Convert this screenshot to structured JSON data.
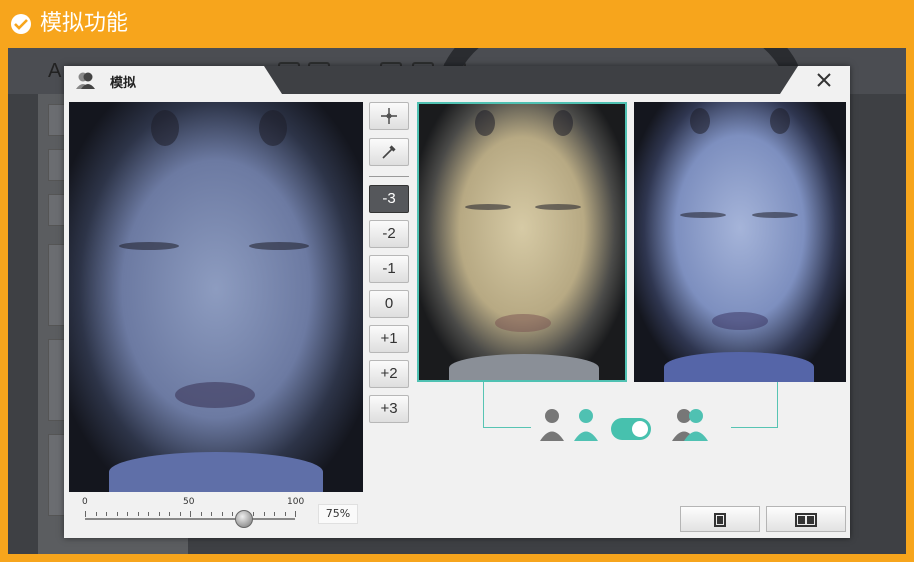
{
  "banner": {
    "title": "模拟功能",
    "icon": "check-circle-icon"
  },
  "background": {
    "toolbar_letter": "A"
  },
  "dialog": {
    "title": "模拟",
    "close_icon": "close-icon",
    "tools": {
      "levels": [
        "-3",
        "-2",
        "-1",
        "0",
        "+1",
        "+2",
        "+3"
      ],
      "selected": "-3"
    },
    "slider": {
      "min_label": "0",
      "mid_label": "50",
      "max_label": "100",
      "value": 75,
      "value_label": "75%"
    },
    "compare_toggle": {
      "on": true
    },
    "colors": {
      "accent": "#4fc1b2",
      "banner": "#f7a51c",
      "dark_bg": "#3e4044"
    }
  }
}
